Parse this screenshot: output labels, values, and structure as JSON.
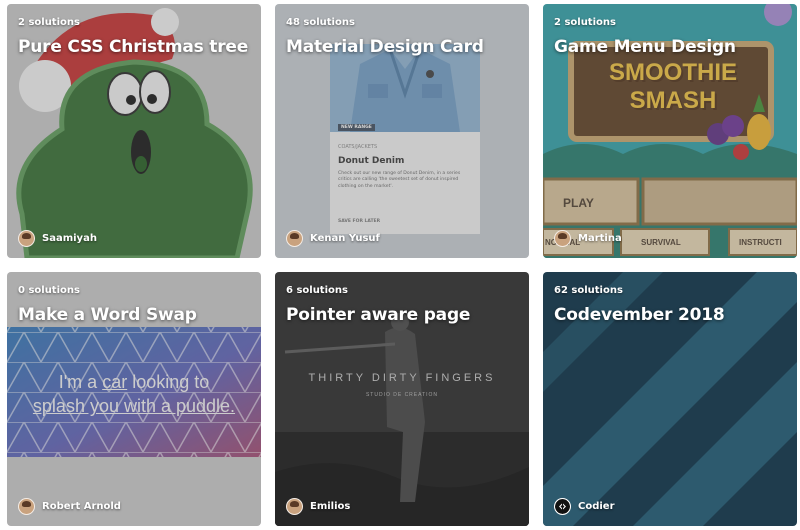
{
  "cards": [
    {
      "solutions": "2 solutions",
      "title": "Pure CSS Christmas tree",
      "author": "Saamiyah"
    },
    {
      "solutions": "48 solutions",
      "title": "Material Design Card",
      "author": "Kenan Yusuf",
      "preview": {
        "tag": "NEW RANGE",
        "category": "COATS/JACKETS",
        "name": "Donut Denim",
        "description": "Check out our new range of Donut Denim, in a series critics are calling 'the sweetest set of donut inspired clothing on the market'.",
        "action": "SAVE FOR LATER"
      }
    },
    {
      "solutions": "2 solutions",
      "title": "Game Menu Design",
      "author": "Martina",
      "preview": {
        "logo_line1": "SMOOTHIE",
        "logo_line2": "SMASH",
        "btn_play": "PLAY",
        "btn_normal": "NORMAL",
        "btn_survival": "SURVIVAL",
        "btn_instructions": "INSTRUCTI"
      }
    },
    {
      "solutions": "0 solutions",
      "title": "Make a Word Swap",
      "author": "Robert Arnold",
      "preview": {
        "line1_pre": "I'm a ",
        "line1_word": "car",
        "line1_post": " looking to",
        "line2": "splash you with a puddle."
      }
    },
    {
      "solutions": "6 solutions",
      "title": "Pointer aware page",
      "author": "Emilios",
      "preview": {
        "headline": "THIRTY DIRTY FINGERS",
        "sub": "STUDIO DE CREATION"
      }
    },
    {
      "solutions": "62 solutions",
      "title": "Codevember 2018",
      "author": "Codier"
    }
  ],
  "colors": {
    "overlay": "#6e6e6e",
    "text": "#ffffff"
  },
  "icons": [
    "user-avatar-icon",
    "codier-logo-icon"
  ]
}
